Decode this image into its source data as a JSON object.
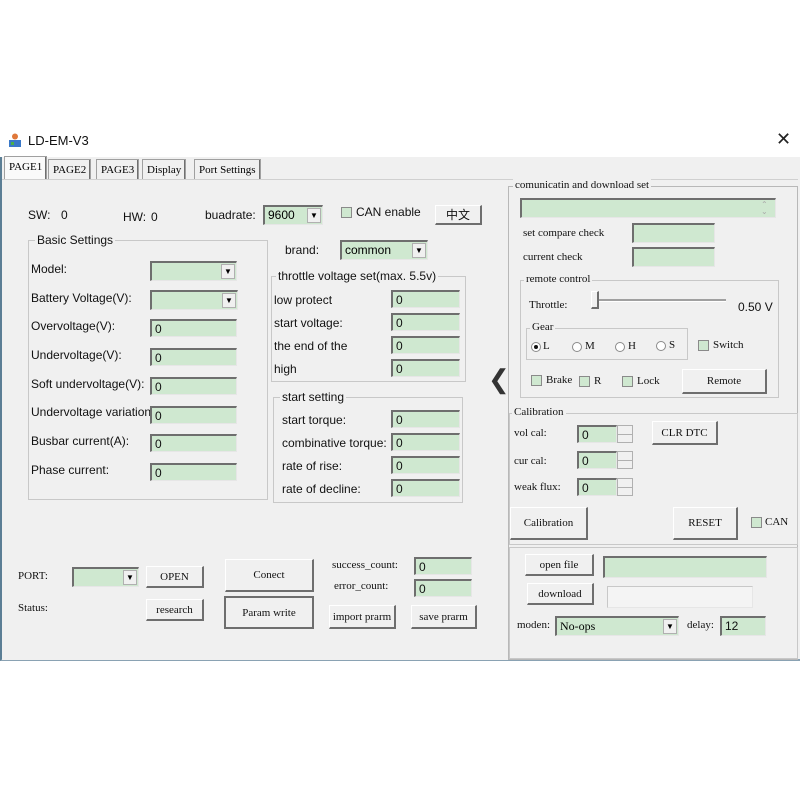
{
  "window": {
    "title": "LD-EM-V3",
    "close_glyph": "✕",
    "collapse_glyph": "❮"
  },
  "tabs": [
    {
      "label": "PAGE1",
      "active": true
    },
    {
      "label": "PAGE2",
      "active": false
    },
    {
      "label": "PAGE3",
      "active": false
    },
    {
      "label": "Display",
      "active": false
    },
    {
      "label": "Port Settings",
      "active": false
    }
  ],
  "header": {
    "sw_label": "SW:",
    "sw_value": "0",
    "hw_label": "HW:",
    "hw_value": "0",
    "baudrate_label": "buadrate:",
    "baudrate_value": "9600",
    "can_enable_label": "CAN enable",
    "language_button": "中文"
  },
  "basic_settings": {
    "title": "Basic Settings",
    "rows": [
      {
        "label": "Model:",
        "type": "combo",
        "value": ""
      },
      {
        "label": "Battery Voltage(V):",
        "type": "combo",
        "value": ""
      },
      {
        "label": "Overvoltage(V):",
        "type": "field",
        "value": "0"
      },
      {
        "label": "Undervoltage(V):",
        "type": "field",
        "value": "0"
      },
      {
        "label": "Soft undervoltage(V):",
        "type": "field",
        "value": "0"
      },
      {
        "label": "Undervoltage variation:",
        "type": "field",
        "value": "0"
      },
      {
        "label": "Busbar current(A):",
        "type": "field",
        "value": "0"
      },
      {
        "label": "Phase current:",
        "type": "field",
        "value": "0"
      }
    ]
  },
  "brand": {
    "label": "brand:",
    "value": "common"
  },
  "throttle_voltage": {
    "title": "throttle voltage set(max. 5.5v)",
    "rows": [
      {
        "label": "low protect",
        "value": "0"
      },
      {
        "label": "start voltage:",
        "value": "0"
      },
      {
        "label": "the end of the",
        "value": "0"
      },
      {
        "label": "high",
        "value": "0"
      }
    ]
  },
  "start_setting": {
    "title": "start setting",
    "rows": [
      {
        "label": "start torque:",
        "value": "0"
      },
      {
        "label": "combinative torque:",
        "value": "0"
      },
      {
        "label": "rate of rise:",
        "value": "0"
      },
      {
        "label": "rate of decline:",
        "value": "0"
      }
    ]
  },
  "bottom": {
    "port_label": "PORT:",
    "port_value": "",
    "open_button": "OPEN",
    "status_label": "Status:",
    "research_button": "research",
    "connect_button": "Conect",
    "param_write_button": "Param write",
    "success_count_label": "success_count:",
    "success_count_value": "0",
    "error_count_label": "error_count:",
    "error_count_value": "0",
    "import_button": "import prarm",
    "save_button": "save prarm"
  },
  "communication": {
    "title": "comunicatin and download set",
    "message_value": "",
    "set_compare_check_label": "set compare check",
    "set_compare_check_value": "",
    "current_check_label": "current check",
    "current_check_value": ""
  },
  "remote_control": {
    "title": "remote control",
    "throttle_label": "Throttle:",
    "throttle_value_text": "0.50 V",
    "throttle_slider_fraction": 0.0,
    "gear_title": "Gear",
    "gears": [
      {
        "label": "L",
        "selected": true
      },
      {
        "label": "M",
        "selected": false
      },
      {
        "label": "H",
        "selected": false
      },
      {
        "label": "S",
        "selected": false
      }
    ],
    "switch_label": "Switch",
    "brake_label": "Brake",
    "r_label": "R",
    "lock_label": "Lock",
    "remote_button": "Remote"
  },
  "calibration": {
    "title": "Calibration",
    "rows": [
      {
        "label": "vol cal:",
        "value": "0"
      },
      {
        "label": "cur cal:",
        "value": "0"
      },
      {
        "label": "weak flux:",
        "value": "0"
      }
    ],
    "clr_dtc_button": "CLR DTC",
    "calibration_button": "Calibration",
    "reset_button": "RESET",
    "can_label": "CAN"
  },
  "download": {
    "open_file_button": "open file",
    "file_path_value": "",
    "download_button": "download",
    "progress_value": "",
    "moden_label": "moden:",
    "moden_value": "No-ops",
    "delay_label": "delay:",
    "delay_value": "12"
  }
}
